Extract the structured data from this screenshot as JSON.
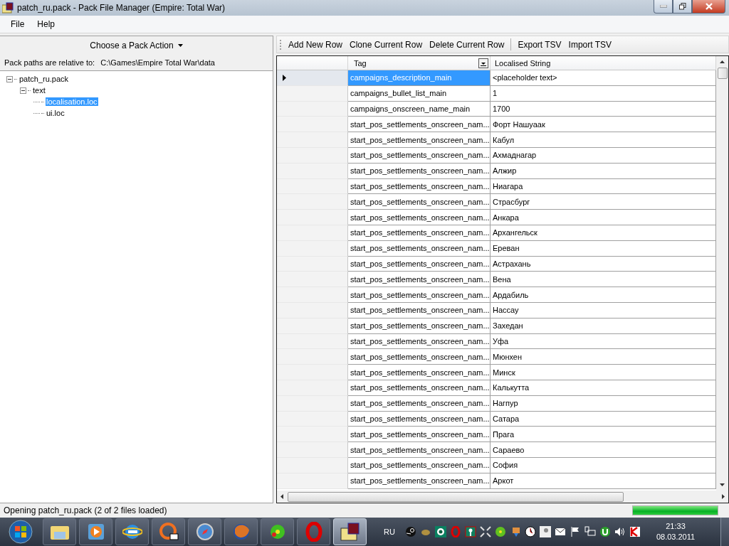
{
  "window": {
    "title": "patch_ru.pack - Pack File Manager (Empire: Total War)"
  },
  "menu": [
    "File",
    "Help"
  ],
  "pack_panel": {
    "action_button": "Choose a Pack Action",
    "path_label": "Pack paths are relative to:",
    "path_value": "C:\\Games\\Empire Total War\\data",
    "tree": [
      {
        "label": "patch_ru.pack",
        "expanded": true,
        "selected": false,
        "children": [
          {
            "label": "text",
            "expanded": true,
            "selected": false,
            "children": [
              {
                "label": "localisation.loc",
                "selected": true
              },
              {
                "label": "ui.loc",
                "selected": false
              }
            ]
          }
        ]
      }
    ]
  },
  "toolbar": [
    {
      "kind": "button",
      "label": "Add New Row"
    },
    {
      "kind": "button",
      "label": "Clone Current Row"
    },
    {
      "kind": "button",
      "label": "Delete Current Row"
    },
    {
      "kind": "separator"
    },
    {
      "kind": "button",
      "label": "Export TSV"
    },
    {
      "kind": "button",
      "label": "Import TSV"
    }
  ],
  "table": {
    "columns": [
      "Tag",
      "Localised String"
    ],
    "rows": [
      {
        "tag": "campaigns_description_main",
        "value": "<placeholder text>",
        "selected": true
      },
      {
        "tag": "campaigns_bullet_list_main",
        "value": "1",
        "selected": false
      },
      {
        "tag": "campaigns_onscreen_name_main",
        "value": "1700",
        "selected": false
      },
      {
        "tag": "start_pos_settlements_onscreen_nam...",
        "value": "Форт Нашуаак",
        "selected": false
      },
      {
        "tag": "start_pos_settlements_onscreen_nam...",
        "value": "Кабул",
        "selected": false
      },
      {
        "tag": "start_pos_settlements_onscreen_nam...",
        "value": "Ахмаднагар",
        "selected": false
      },
      {
        "tag": "start_pos_settlements_onscreen_nam...",
        "value": "Алжир",
        "selected": false
      },
      {
        "tag": "start_pos_settlements_onscreen_nam...",
        "value": "Ниагара",
        "selected": false
      },
      {
        "tag": "start_pos_settlements_onscreen_nam...",
        "value": "Страсбург",
        "selected": false
      },
      {
        "tag": "start_pos_settlements_onscreen_nam...",
        "value": "Анкара",
        "selected": false
      },
      {
        "tag": "start_pos_settlements_onscreen_nam...",
        "value": "Архангельск",
        "selected": false
      },
      {
        "tag": "start_pos_settlements_onscreen_nam...",
        "value": "Ереван",
        "selected": false
      },
      {
        "tag": "start_pos_settlements_onscreen_nam...",
        "value": "Астрахань",
        "selected": false
      },
      {
        "tag": "start_pos_settlements_onscreen_nam...",
        "value": "Вена",
        "selected": false
      },
      {
        "tag": "start_pos_settlements_onscreen_nam...",
        "value": "Ардабиль",
        "selected": false
      },
      {
        "tag": "start_pos_settlements_onscreen_nam...",
        "value": "Нассау",
        "selected": false
      },
      {
        "tag": "start_pos_settlements_onscreen_nam...",
        "value": "Захедан",
        "selected": false
      },
      {
        "tag": "start_pos_settlements_onscreen_nam...",
        "value": "Уфа",
        "selected": false
      },
      {
        "tag": "start_pos_settlements_onscreen_nam...",
        "value": "Мюнхен",
        "selected": false
      },
      {
        "tag": "start_pos_settlements_onscreen_nam...",
        "value": "Минск",
        "selected": false
      },
      {
        "tag": "start_pos_settlements_onscreen_nam...",
        "value": "Калькутта",
        "selected": false
      },
      {
        "tag": "start_pos_settlements_onscreen_nam...",
        "value": "Нагпур",
        "selected": false
      },
      {
        "tag": "start_pos_settlements_onscreen_nam...",
        "value": "Сатара",
        "selected": false
      },
      {
        "tag": "start_pos_settlements_onscreen_nam...",
        "value": "Прага",
        "selected": false
      },
      {
        "tag": "start_pos_settlements_onscreen_nam...",
        "value": "Сараево",
        "selected": false
      },
      {
        "tag": "start_pos_settlements_onscreen_nam...",
        "value": "София",
        "selected": false
      },
      {
        "tag": "start_pos_settlements_onscreen_nam...",
        "value": "Аркот",
        "selected": false
      }
    ]
  },
  "status_bar": {
    "text": "Opening patch_ru.pack (2 of 2 files loaded)",
    "level": 1
  },
  "taskbar": {
    "language": "RU",
    "time": "21:33",
    "date": "08.03.2011"
  }
}
